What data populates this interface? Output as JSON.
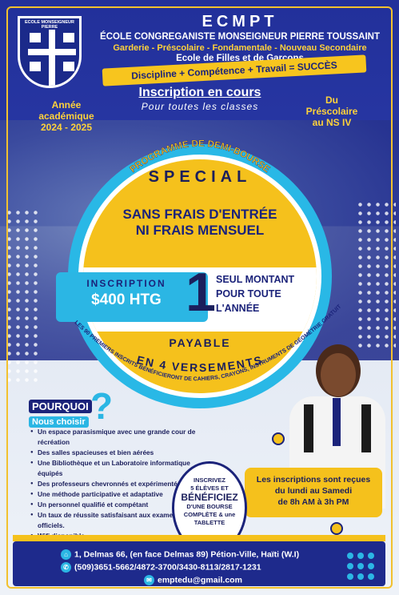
{
  "logo": {
    "ring_text": "ECOLE MONSEIGNEUR PIERRE",
    "bottom_text": "Compétence + Discipline + Travail = Succès"
  },
  "header": {
    "acronym": "ECMPT",
    "school_name": "ÉCOLE CONGREGANISTE MONSEIGNEUR PIERRE TOUSSAINT",
    "levels": "Garderie - Préscolaire - Fondamentale - Nouveau Secondaire",
    "gender": "Ecole de Filles et de Garçons",
    "motto": "Discipline + Compétence + Travail = SUCCÈS"
  },
  "inscription": {
    "title": "Inscription en cours",
    "subtitle": "Pour toutes les classes"
  },
  "year": {
    "line1": "Année",
    "line2": "académique",
    "line3": "2024 - 2025"
  },
  "range": {
    "line1": "Du",
    "line2": "Préscolaire",
    "line3": "au NS IV"
  },
  "program_title": "PROGRAMME DE DEMI-BOURSE",
  "offer": {
    "special": "SPECIAL",
    "no_fees_1": "SANS FRAIS D'ENTRÉE",
    "no_fees_2": "NI FRAIS MENSUEL",
    "ins_label": "INSCRIPTION",
    "ins_price": "$400 HTG",
    "big_one": "1",
    "single_1": "SEUL MONTANT",
    "single_2": "POUR TOUTE",
    "single_3": "L'ANNÉE",
    "payable": "PAYABLE",
    "versements": "EN 4 VERSEMENTS",
    "free_note": "LES 90 PREMIERS INSCRITS BÉNÉFICIERONT DE CAHIERS, CRAYONS, INSTRUMENTS DE GÉOMÉTRIE GRATUIT"
  },
  "why": {
    "title": "POURQUOI",
    "subtitle": "Nous choisir",
    "qmark": "?",
    "items": [
      "Un espace parasismique avec une grande cour de récréation",
      "Des salles spacieuses et bien aérées",
      "Une Bibliothèque et un Laboratoire informatique équipés",
      "Des professeurs chevronnés et expérimentés",
      "Une méthode participative et adaptative",
      "Un personnel qualifié et compétant",
      "Un taux de réussite satisfaisant aux examens officiels.",
      "Wifi disponible"
    ]
  },
  "promo": {
    "line1": "INSCRIVEZ",
    "line2": "5 ÉLÈVES ET",
    "line3": "BÉNÉFICIEZ",
    "line4": "D'UNE BOURSE",
    "line5": "COMPLÈTE & une",
    "line6": "TABLETTE"
  },
  "dates": {
    "line1": "Les inscriptions sont reçues",
    "line2": "du lundi au Samedi",
    "line3": "de 8h AM à 3h PM"
  },
  "footer": {
    "address": "1, Delmas 66, (en face Delmas 89) Pétion-Ville, Haïti (W.I)",
    "phones": "(509)3651-5662/4872-3700/3430-8113/2817-1231",
    "email": "emptedu@gmail.com"
  },
  "colors": {
    "navy": "#1e2a8c",
    "yellow": "#f5c11c",
    "cyan": "#2bb6e4"
  }
}
